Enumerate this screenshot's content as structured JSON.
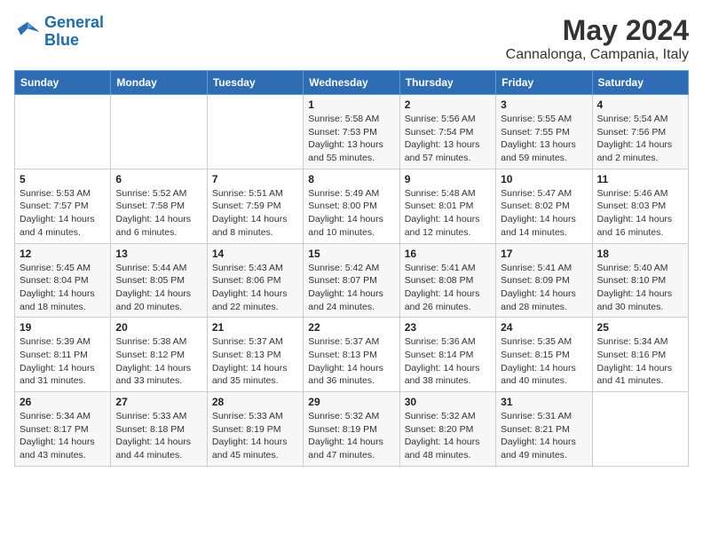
{
  "header": {
    "logo_line1": "General",
    "logo_line2": "Blue",
    "title": "May 2024",
    "subtitle": "Cannalonga, Campania, Italy"
  },
  "weekdays": [
    "Sunday",
    "Monday",
    "Tuesday",
    "Wednesday",
    "Thursday",
    "Friday",
    "Saturday"
  ],
  "weeks": [
    [
      {
        "day": "",
        "info": ""
      },
      {
        "day": "",
        "info": ""
      },
      {
        "day": "",
        "info": ""
      },
      {
        "day": "1",
        "info": "Sunrise: 5:58 AM\nSunset: 7:53 PM\nDaylight: 13 hours\nand 55 minutes."
      },
      {
        "day": "2",
        "info": "Sunrise: 5:56 AM\nSunset: 7:54 PM\nDaylight: 13 hours\nand 57 minutes."
      },
      {
        "day": "3",
        "info": "Sunrise: 5:55 AM\nSunset: 7:55 PM\nDaylight: 13 hours\nand 59 minutes."
      },
      {
        "day": "4",
        "info": "Sunrise: 5:54 AM\nSunset: 7:56 PM\nDaylight: 14 hours\nand 2 minutes."
      }
    ],
    [
      {
        "day": "5",
        "info": "Sunrise: 5:53 AM\nSunset: 7:57 PM\nDaylight: 14 hours\nand 4 minutes."
      },
      {
        "day": "6",
        "info": "Sunrise: 5:52 AM\nSunset: 7:58 PM\nDaylight: 14 hours\nand 6 minutes."
      },
      {
        "day": "7",
        "info": "Sunrise: 5:51 AM\nSunset: 7:59 PM\nDaylight: 14 hours\nand 8 minutes."
      },
      {
        "day": "8",
        "info": "Sunrise: 5:49 AM\nSunset: 8:00 PM\nDaylight: 14 hours\nand 10 minutes."
      },
      {
        "day": "9",
        "info": "Sunrise: 5:48 AM\nSunset: 8:01 PM\nDaylight: 14 hours\nand 12 minutes."
      },
      {
        "day": "10",
        "info": "Sunrise: 5:47 AM\nSunset: 8:02 PM\nDaylight: 14 hours\nand 14 minutes."
      },
      {
        "day": "11",
        "info": "Sunrise: 5:46 AM\nSunset: 8:03 PM\nDaylight: 14 hours\nand 16 minutes."
      }
    ],
    [
      {
        "day": "12",
        "info": "Sunrise: 5:45 AM\nSunset: 8:04 PM\nDaylight: 14 hours\nand 18 minutes."
      },
      {
        "day": "13",
        "info": "Sunrise: 5:44 AM\nSunset: 8:05 PM\nDaylight: 14 hours\nand 20 minutes."
      },
      {
        "day": "14",
        "info": "Sunrise: 5:43 AM\nSunset: 8:06 PM\nDaylight: 14 hours\nand 22 minutes."
      },
      {
        "day": "15",
        "info": "Sunrise: 5:42 AM\nSunset: 8:07 PM\nDaylight: 14 hours\nand 24 minutes."
      },
      {
        "day": "16",
        "info": "Sunrise: 5:41 AM\nSunset: 8:08 PM\nDaylight: 14 hours\nand 26 minutes."
      },
      {
        "day": "17",
        "info": "Sunrise: 5:41 AM\nSunset: 8:09 PM\nDaylight: 14 hours\nand 28 minutes."
      },
      {
        "day": "18",
        "info": "Sunrise: 5:40 AM\nSunset: 8:10 PM\nDaylight: 14 hours\nand 30 minutes."
      }
    ],
    [
      {
        "day": "19",
        "info": "Sunrise: 5:39 AM\nSunset: 8:11 PM\nDaylight: 14 hours\nand 31 minutes."
      },
      {
        "day": "20",
        "info": "Sunrise: 5:38 AM\nSunset: 8:12 PM\nDaylight: 14 hours\nand 33 minutes."
      },
      {
        "day": "21",
        "info": "Sunrise: 5:37 AM\nSunset: 8:13 PM\nDaylight: 14 hours\nand 35 minutes."
      },
      {
        "day": "22",
        "info": "Sunrise: 5:37 AM\nSunset: 8:13 PM\nDaylight: 14 hours\nand 36 minutes."
      },
      {
        "day": "23",
        "info": "Sunrise: 5:36 AM\nSunset: 8:14 PM\nDaylight: 14 hours\nand 38 minutes."
      },
      {
        "day": "24",
        "info": "Sunrise: 5:35 AM\nSunset: 8:15 PM\nDaylight: 14 hours\nand 40 minutes."
      },
      {
        "day": "25",
        "info": "Sunrise: 5:34 AM\nSunset: 8:16 PM\nDaylight: 14 hours\nand 41 minutes."
      }
    ],
    [
      {
        "day": "26",
        "info": "Sunrise: 5:34 AM\nSunset: 8:17 PM\nDaylight: 14 hours\nand 43 minutes."
      },
      {
        "day": "27",
        "info": "Sunrise: 5:33 AM\nSunset: 8:18 PM\nDaylight: 14 hours\nand 44 minutes."
      },
      {
        "day": "28",
        "info": "Sunrise: 5:33 AM\nSunset: 8:19 PM\nDaylight: 14 hours\nand 45 minutes."
      },
      {
        "day": "29",
        "info": "Sunrise: 5:32 AM\nSunset: 8:19 PM\nDaylight: 14 hours\nand 47 minutes."
      },
      {
        "day": "30",
        "info": "Sunrise: 5:32 AM\nSunset: 8:20 PM\nDaylight: 14 hours\nand 48 minutes."
      },
      {
        "day": "31",
        "info": "Sunrise: 5:31 AM\nSunset: 8:21 PM\nDaylight: 14 hours\nand 49 minutes."
      },
      {
        "day": "",
        "info": ""
      }
    ]
  ]
}
